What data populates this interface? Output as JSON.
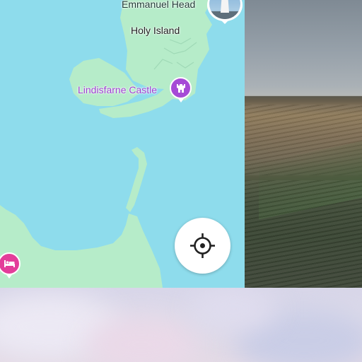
{
  "map": {
    "labels": {
      "emmanuel_head": "Emmanuel Head",
      "holy_island": "Holy Island",
      "lindisfarne_castle": "Lindisfarne Castle"
    },
    "colors": {
      "water": "#8edcec",
      "land": "#b6ecc9",
      "castle_pin": "#a64ad6",
      "hotel_pin": "#e33d9a"
    },
    "pins": {
      "castle_icon": "castle-icon",
      "hotel_icon": "bed-icon",
      "photo_icon": "lighthouse-photo"
    },
    "locate_button_icon": "crosshair-icon"
  },
  "photo_panel": {
    "description_icon": "field-photo"
  }
}
